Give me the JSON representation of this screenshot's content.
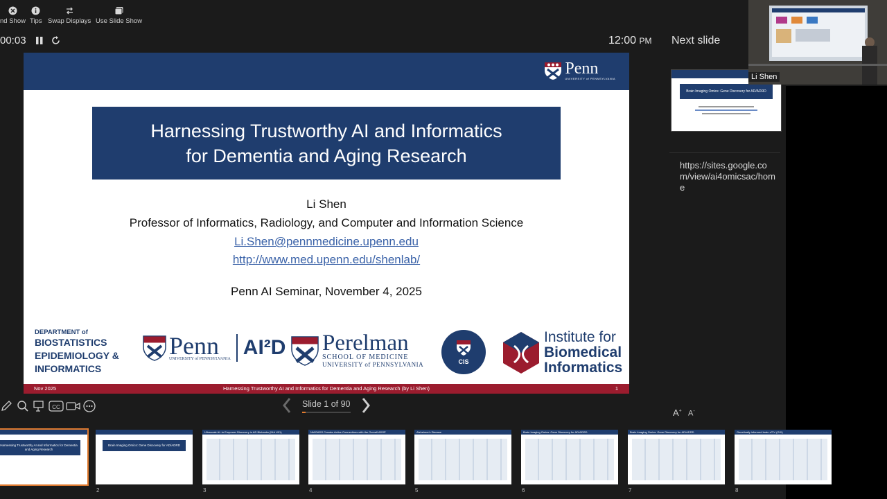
{
  "toolbar": {
    "end_show": "nd Show",
    "tips": "Tips",
    "swap": "Swap Displays",
    "use_slideshow": "Use Slide Show"
  },
  "timer": "00:03",
  "clock": {
    "time": "12:00",
    "ampm": "PM"
  },
  "next_slide_label": "Next slide",
  "slide": {
    "title_line1": "Harnessing Trustworthy AI and Informatics",
    "title_line2": "for Dementia and Aging Research",
    "author": "Li Shen",
    "role": "Professor of Informatics, Radiology, and Computer and Information Science",
    "email": "Li.Shen@pennmedicine.upenn.edu",
    "url": "http://www.med.upenn.edu/shenlab/",
    "event": "Penn AI Seminar, November 4, 2025",
    "footer_left": "Nov 2025",
    "footer_center": "Harnessing Trustworthy AI and Informatics for Dementia and Aging Research (by Li Shen)",
    "footer_right": "1",
    "penn_word": "Penn",
    "penn_sub": "UNIVERSITY of PENNSYLVANIA",
    "dept": {
      "line0": "DEPARTMENT of",
      "line1": "BIOSTATISTICS",
      "line2": "EPIDEMIOLOGY &",
      "line3": "INFORMATICS"
    },
    "penn_ai2d": {
      "penn": "Penn",
      "sub": "UNIVERSITY of PENNSYLVANIA",
      "ai2d": "AI²D"
    },
    "perelman": {
      "name": "Perelman",
      "l2": "SCHOOL OF MEDICINE",
      "l3": "UNIVERSITY of PENNSYLVANIA"
    },
    "cis": "CIS",
    "ibi": {
      "l1": "Institute for",
      "l2": "Biomedical",
      "l3": "Informatics"
    }
  },
  "slide_counter": "Slide 1 of 90",
  "next_thumb": {
    "title": "Brain Imaging Omics: Gene Discovery for AD/ADRD"
  },
  "notes_text": "https://sites.google.com/view/ai4omicsac/home",
  "font_controls": {
    "larger": "A",
    "smaller": "A"
  },
  "video_name": "Li Shen",
  "thumbnails": [
    {
      "num": "",
      "title": "Harnessing Trustworthy AI and Informatics for Dementia and Aging Research"
    },
    {
      "num": "2",
      "title": "Brain Imaging Omics: Gene Discovery for AD/ADRD"
    },
    {
      "num": "3",
      "title": "Ultrascale AI: to Empower Discovery in AD Biobanks (NIA U01)"
    },
    {
      "num": "4",
      "title": "NIAGADS Creates Active Connections with the Overall ADSP"
    },
    {
      "num": "5",
      "title": "Alzheimer's Disease"
    },
    {
      "num": "6",
      "title": "Brain Imaging Omics: Gene Discovery for AD/ADRD"
    },
    {
      "num": "7",
      "title": "Brain Imaging Omics: Gene Discovery for AD/ADRD"
    },
    {
      "num": "8",
      "title": "Genetically informed brain eTIV (GIX)"
    }
  ]
}
